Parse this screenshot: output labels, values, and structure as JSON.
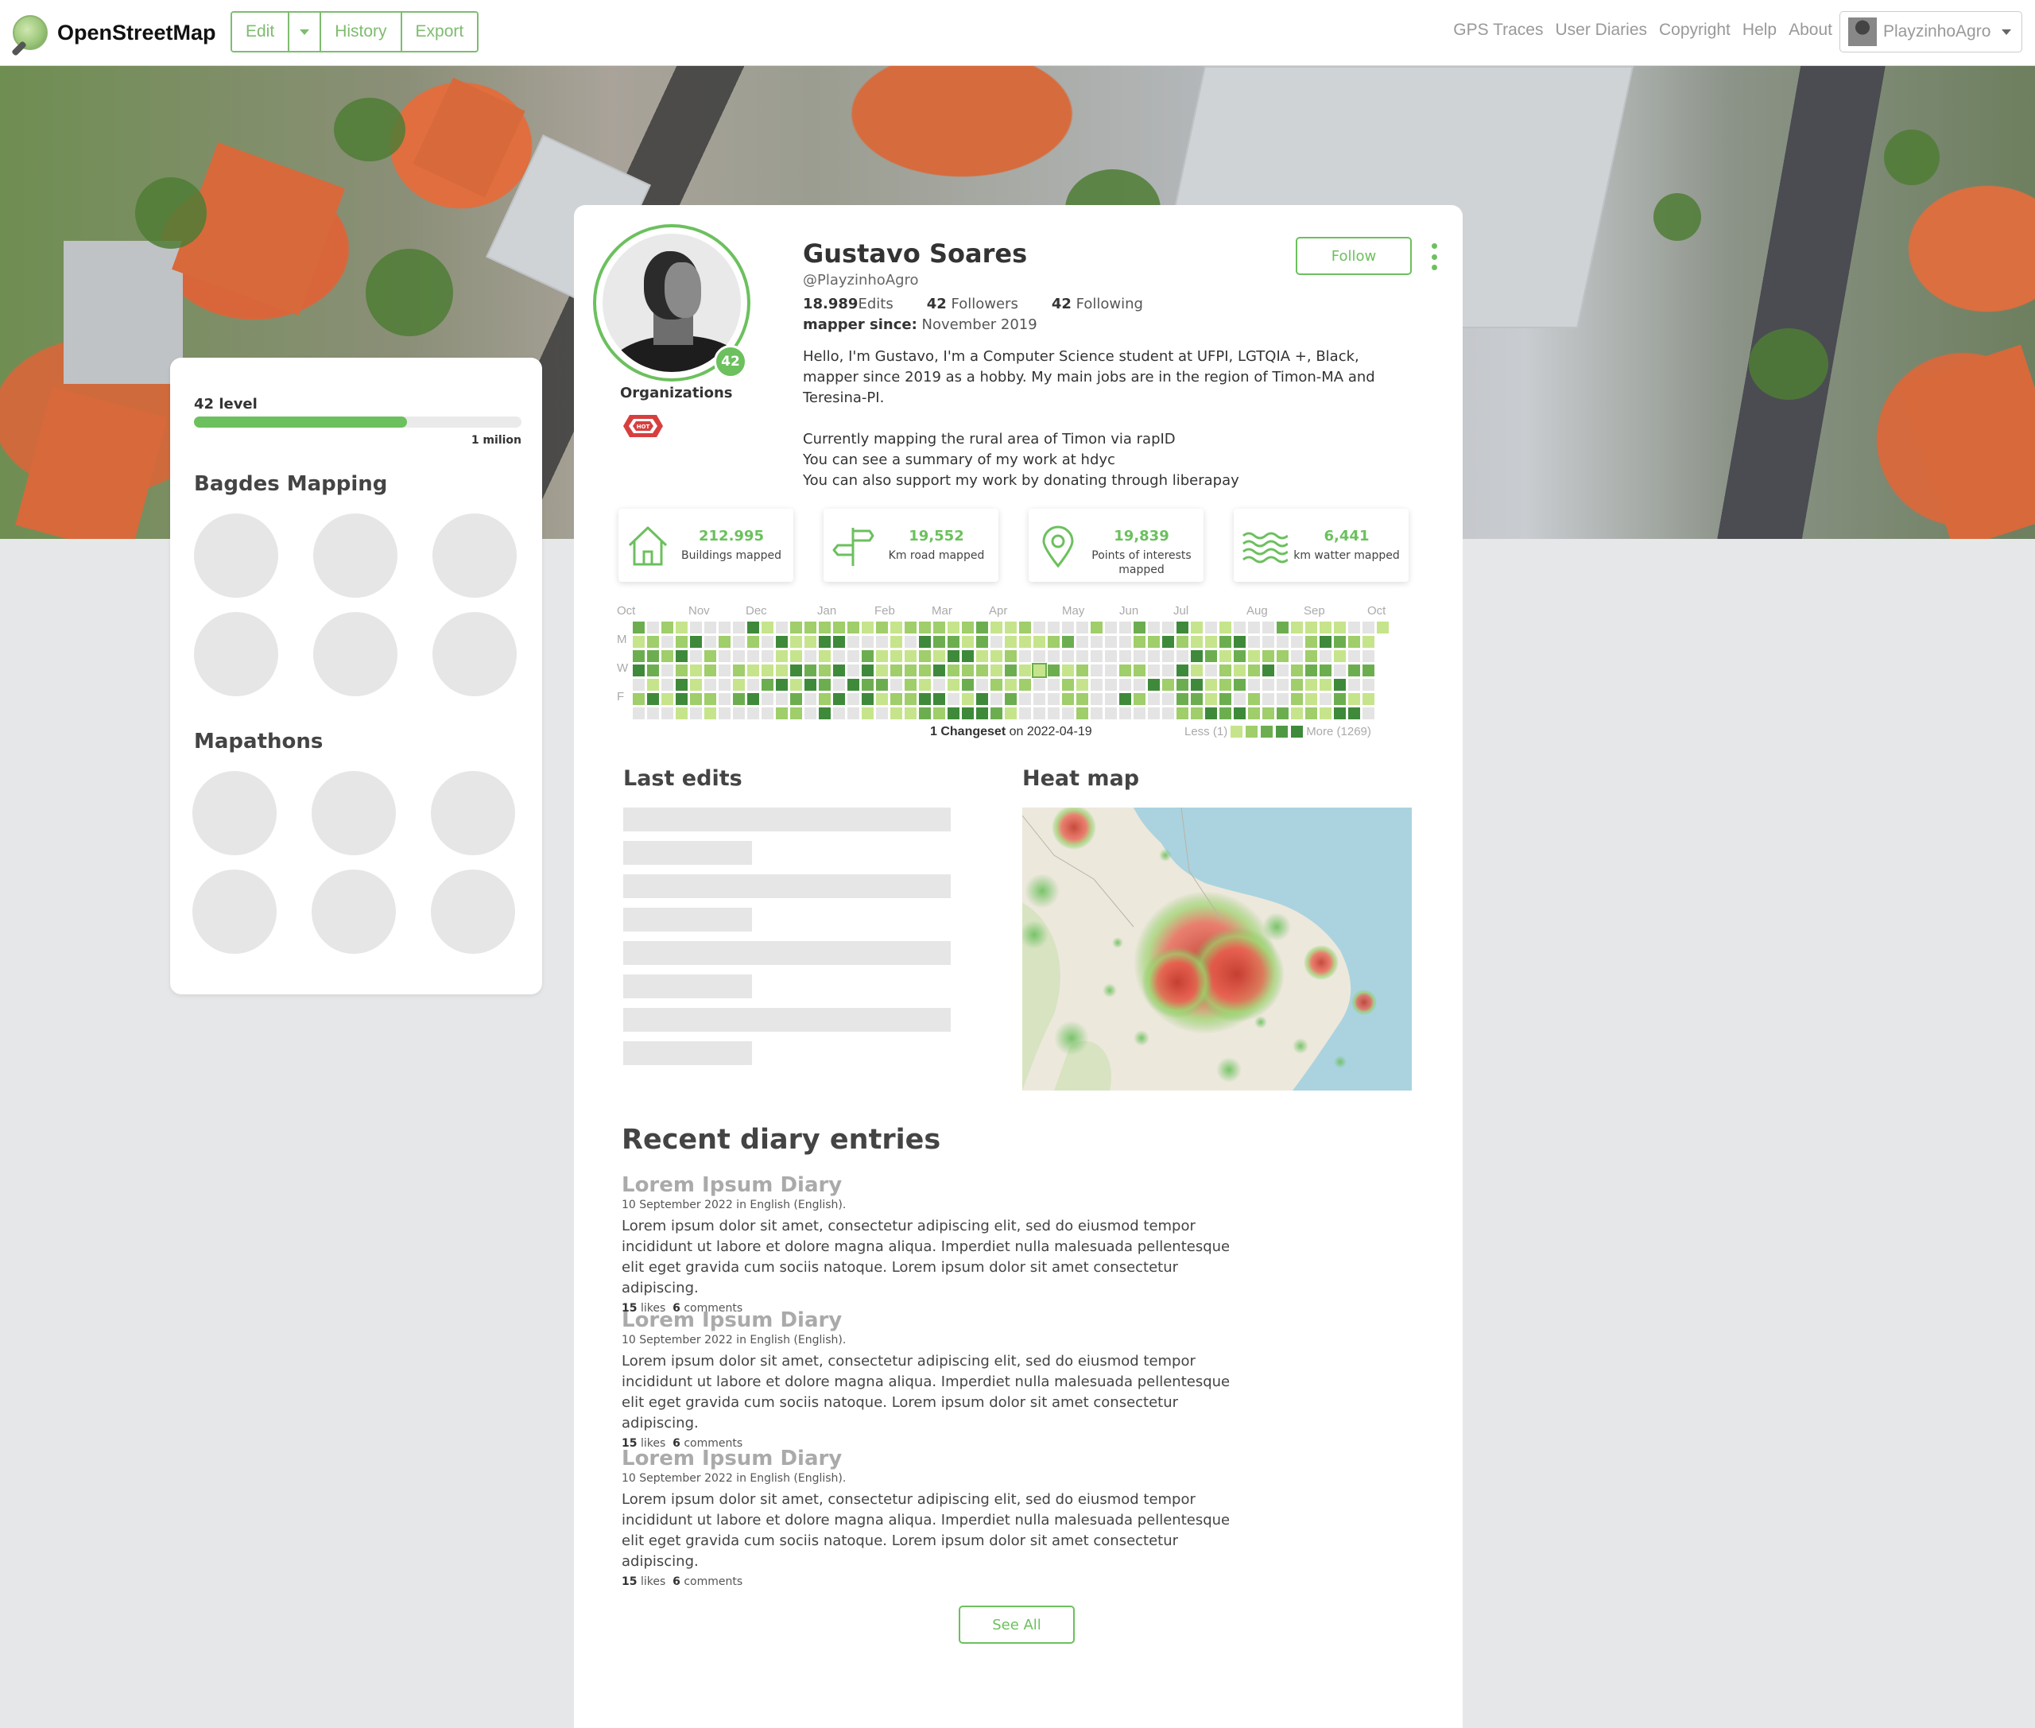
{
  "brand": {
    "name": "OpenStreetMap"
  },
  "edit_menu": {
    "edit": "Edit",
    "history": "History",
    "export": "Export"
  },
  "nav": {
    "gps_traces": "GPS Traces",
    "user_diaries": "User Diaries",
    "copyright": "Copyright",
    "help": "Help",
    "about": "About"
  },
  "user_menu": {
    "username": "PlayzinhoAgro"
  },
  "left_panel": {
    "level_label": "42 level",
    "level_progress": 0.65,
    "level_max": "1 milion",
    "badges_title": "Bagdes Mapping",
    "mapathons_title": "Mapathons"
  },
  "profile": {
    "name": "Gustavo Soares",
    "handle": "@PlayzinhoAgro",
    "level": "42",
    "edits_num": "18.989",
    "edits_label": "Edits",
    "followers_num": "42",
    "followers_label": "Followers",
    "following_num": "42",
    "following_label": "Following",
    "since_label": "mapper since:",
    "since_value": "November 2019",
    "organizations_label": "Organizations",
    "org_badge": "HOT",
    "follow_label": "Follow",
    "bio": [
      "Hello, I'm Gustavo, I'm a Computer Science student at UFPI, LGTQIA +, Black, mapper since 2019 as a hobby. My main jobs are in the region of Timon-MA and Teresina-PI.",
      "",
      "Currently mapping the rural area of Timon via rapID",
      "You can see a summary of my work at hdyc",
      "You can also support my work by donating through liberapay"
    ]
  },
  "stat_cards": [
    {
      "icon": "house-icon",
      "value": "212.995",
      "label": "Buildings mapped"
    },
    {
      "icon": "signpost-icon",
      "value": "19,552",
      "label": "Km road mapped"
    },
    {
      "icon": "map-pin-icon",
      "value": "19,839",
      "label": "Points of interests mapped"
    },
    {
      "icon": "water-waves-icon",
      "value": "6,441",
      "label": "km watter mapped"
    }
  ],
  "contributions": {
    "months": [
      "Oct",
      "Nov",
      "Dec",
      "Jan",
      "Feb",
      "Mar",
      "Apr",
      "May",
      "Jun",
      "Jul",
      "Aug",
      "Sep",
      "Oct"
    ],
    "days": [
      "M",
      "W",
      "F"
    ],
    "note_count": "1 Changeset",
    "note_date": "on 2022-04-19",
    "legend_less": "Less (1)",
    "legend_more": "More (1269)",
    "colors": [
      "#e4e4e4",
      "#c6e48b",
      "#9fce6a",
      "#6cae4f",
      "#3e8a3a"
    ]
  },
  "sections": {
    "last_edits": "Last edits",
    "heat_map": "Heat map",
    "recent_diary": "Recent diary entries"
  },
  "diary": [
    {
      "title": "Lorem Ipsum Diary",
      "meta": "10 September 2022 in English (English).",
      "body": "Lorem ipsum dolor sit amet, consectetur adipiscing elit, sed do eiusmod tempor incididunt ut labore et dolore magna aliqua. Imperdiet nulla malesuada pellentesque elit eget gravida cum sociis natoque. Lorem ipsum dolor sit amet consectetur adipiscing.",
      "likes": "15",
      "likes_label": "likes",
      "comments": "6",
      "comments_label": "comments"
    },
    {
      "title": "Lorem Ipsum Diary",
      "meta": "10 September 2022 in English (English).",
      "body": "Lorem ipsum dolor sit amet, consectetur adipiscing elit, sed do eiusmod tempor incididunt ut labore et dolore magna aliqua. Imperdiet nulla malesuada pellentesque elit eget gravida cum sociis natoque. Lorem ipsum dolor sit amet consectetur adipiscing.",
      "likes": "15",
      "likes_label": "likes",
      "comments": "6",
      "comments_label": "comments"
    },
    {
      "title": "Lorem Ipsum Diary",
      "meta": "10 September 2022 in English (English).",
      "body": "Lorem ipsum dolor sit amet, consectetur adipiscing elit, sed do eiusmod tempor incididunt ut labore et dolore magna aliqua. Imperdiet nulla malesuada pellentesque elit eget gravida cum sociis natoque. Lorem ipsum dolor sit amet consectetur adipiscing.",
      "likes": "15",
      "likes_label": "likes",
      "comments": "6",
      "comments_label": "comments"
    }
  ],
  "see_all": "See All",
  "colors": {
    "accent": "#6cc05e",
    "osm_green": "#7ebc6f",
    "skeleton": "#e6e6e6"
  }
}
